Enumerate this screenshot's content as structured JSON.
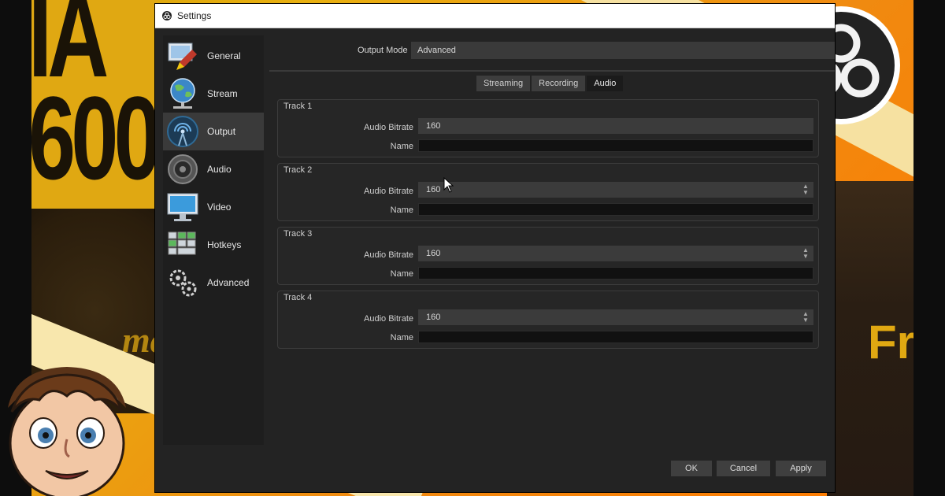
{
  "window": {
    "title": "Settings"
  },
  "sidebar": {
    "items": [
      {
        "label": "General",
        "icon": "general-icon"
      },
      {
        "label": "Stream",
        "icon": "stream-globe-icon"
      },
      {
        "label": "Output",
        "icon": "output-antenna-icon",
        "active": true
      },
      {
        "label": "Audio",
        "icon": "speaker-icon"
      },
      {
        "label": "Video",
        "icon": "monitor-icon"
      },
      {
        "label": "Hotkeys",
        "icon": "keyboard-icon"
      },
      {
        "label": "Advanced",
        "icon": "gears-icon"
      }
    ]
  },
  "output_mode": {
    "label": "Output Mode",
    "value": "Advanced"
  },
  "tabs": [
    {
      "label": "Streaming"
    },
    {
      "label": "Recording"
    },
    {
      "label": "Audio",
      "active": true
    }
  ],
  "tracks": [
    {
      "title": "Track 1",
      "bitrate_label": "Audio Bitrate",
      "bitrate": "160",
      "name_label": "Name",
      "name": ""
    },
    {
      "title": "Track 2",
      "bitrate_label": "Audio Bitrate",
      "bitrate": "160",
      "name_label": "Name",
      "name": ""
    },
    {
      "title": "Track 3",
      "bitrate_label": "Audio Bitrate",
      "bitrate": "160",
      "name_label": "Name",
      "name": ""
    },
    {
      "title": "Track 4",
      "bitrate_label": "Audio Bitrate",
      "bitrate": "160",
      "name_label": "Name",
      "name": ""
    }
  ],
  "buttons": {
    "ok": "OK",
    "cancel": "Cancel",
    "apply": "Apply"
  },
  "background": {
    "big_text": "IA\n600",
    "left_script": "ma",
    "right_text": "Fr"
  },
  "colors": {
    "window_bg": "#232323",
    "accent_orange": "#ff7a00",
    "accent_yellow": "#e0a812"
  }
}
